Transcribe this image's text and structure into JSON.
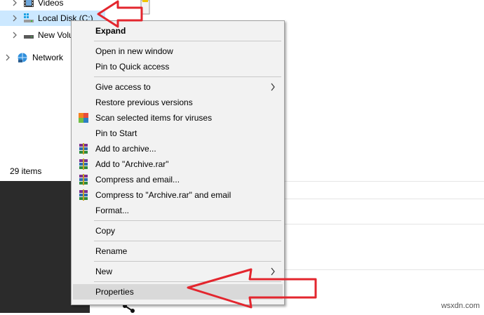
{
  "tree": {
    "videos": "Videos",
    "local_disk": "Local Disk (C:)",
    "new_volume": "New Volu",
    "network": "Network"
  },
  "status": {
    "items_count": "29 items"
  },
  "menu": {
    "expand": "Expand",
    "open_new_window": "Open in new window",
    "pin_quick_access": "Pin to Quick access",
    "give_access": "Give access to",
    "restore_versions": "Restore previous versions",
    "scan_viruses": "Scan selected items for viruses",
    "pin_start": "Pin to Start",
    "add_archive": "Add to archive...",
    "add_archive_rar": "Add to \"Archive.rar\"",
    "compress_email": "Compress and email...",
    "compress_rar_email": "Compress to \"Archive.rar\" and email",
    "format": "Format...",
    "copy": "Copy",
    "rename": "Rename",
    "new": "New",
    "properties": "Properties"
  },
  "watermark": "wsxdn.com",
  "colors": {
    "selection": "#cce8ff",
    "menu_bg": "#f2f2f2",
    "hover": "#d9d9d9",
    "annotation_red": "#e3262e"
  },
  "icons": {
    "videos": "film-icon",
    "local_disk": "windows-drive-icon",
    "new_volume": "drive-icon",
    "network": "network-icon",
    "scan": "antivirus-icon",
    "winrar": "winrar-books-icon",
    "submenu": "chevron-right-icon"
  }
}
